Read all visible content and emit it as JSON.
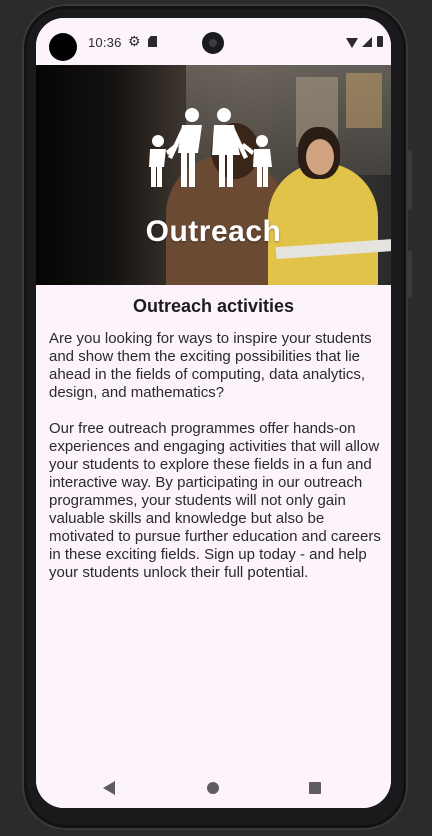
{
  "status_bar": {
    "time": "10:36",
    "icons": [
      "settings-icon",
      "sd-card-icon",
      "wifi-icon",
      "signal-icon",
      "battery-icon"
    ]
  },
  "hero": {
    "title": "Outreach",
    "icon": "family-icon"
  },
  "page": {
    "title": "Outreach activities",
    "paragraphs": [
      "Are you looking for ways to inspire your students and show them the exciting possibilities that lie ahead in the fields of computing, data analytics, design, and mathematics?",
      "Our free outreach programmes offer hands-on experiences and engaging activities that will allow your students to explore these fields in a fun and interactive way. By participating in our outreach programmes, your students will not only gain valuable skills and knowledge but also be motivated to pursue further education and careers in these exciting fields. Sign up today - and help your students unlock their full potential."
    ]
  },
  "nav_bar": {
    "buttons": [
      "back-icon",
      "home-icon",
      "recents-icon"
    ]
  },
  "colors": {
    "background": "#fcf3fc",
    "text": "#1d1b20",
    "frame": "#1a1a1c"
  }
}
